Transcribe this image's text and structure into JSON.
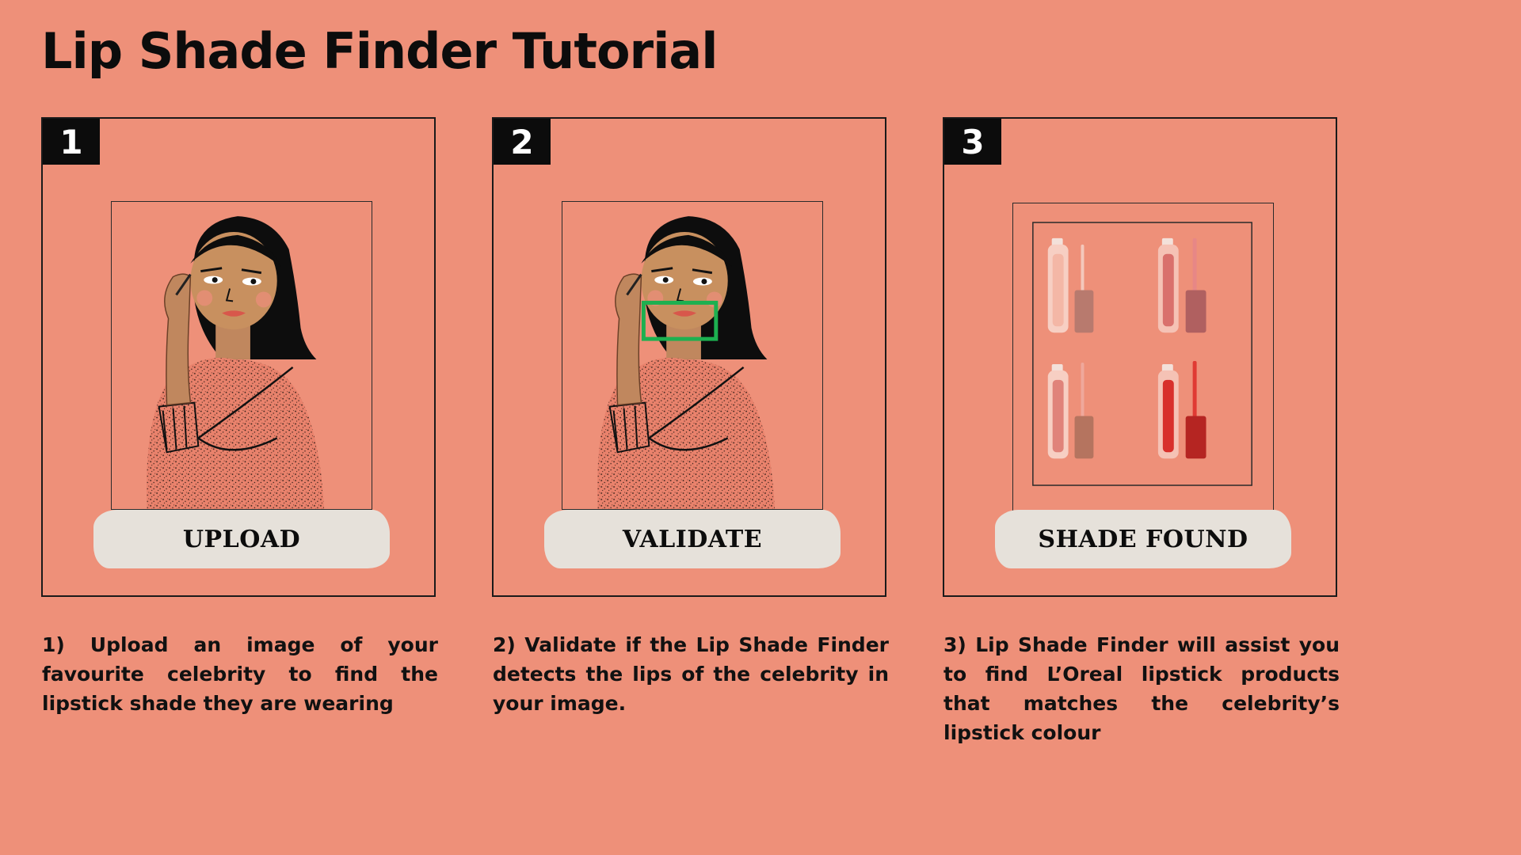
{
  "page": {
    "title": "Lip Shade Finder Tutorial",
    "background_color": "#EE9079"
  },
  "steps": [
    {
      "number": "1",
      "label": "UPLOAD",
      "illustration": "woman-illustration",
      "description": "1) Upload an image of your favourite celebrity to find the lipstick shade they are wearing"
    },
    {
      "number": "2",
      "label": "VALIDATE",
      "illustration": "woman-illustration-with-lip-detection-box",
      "highlight_color": "#1DB050",
      "description": "2) Validate if the Lip Shade Finder detects the lips of the celebrity in your image."
    },
    {
      "number": "3",
      "label": "SHADE FOUND",
      "illustration": "lipstick-products-grid",
      "product_shades": [
        "#F4B7A6",
        "#D9706C",
        "#E0837A",
        "#D8302C"
      ],
      "description": "3) Lip Shade Finder will assist you to find L’Oreal lipstick products that matches the celebrity’s lipstick colour"
    }
  ],
  "colors": {
    "label_pill": "#E6E1DA",
    "number_badge": "#0C0C0C"
  }
}
